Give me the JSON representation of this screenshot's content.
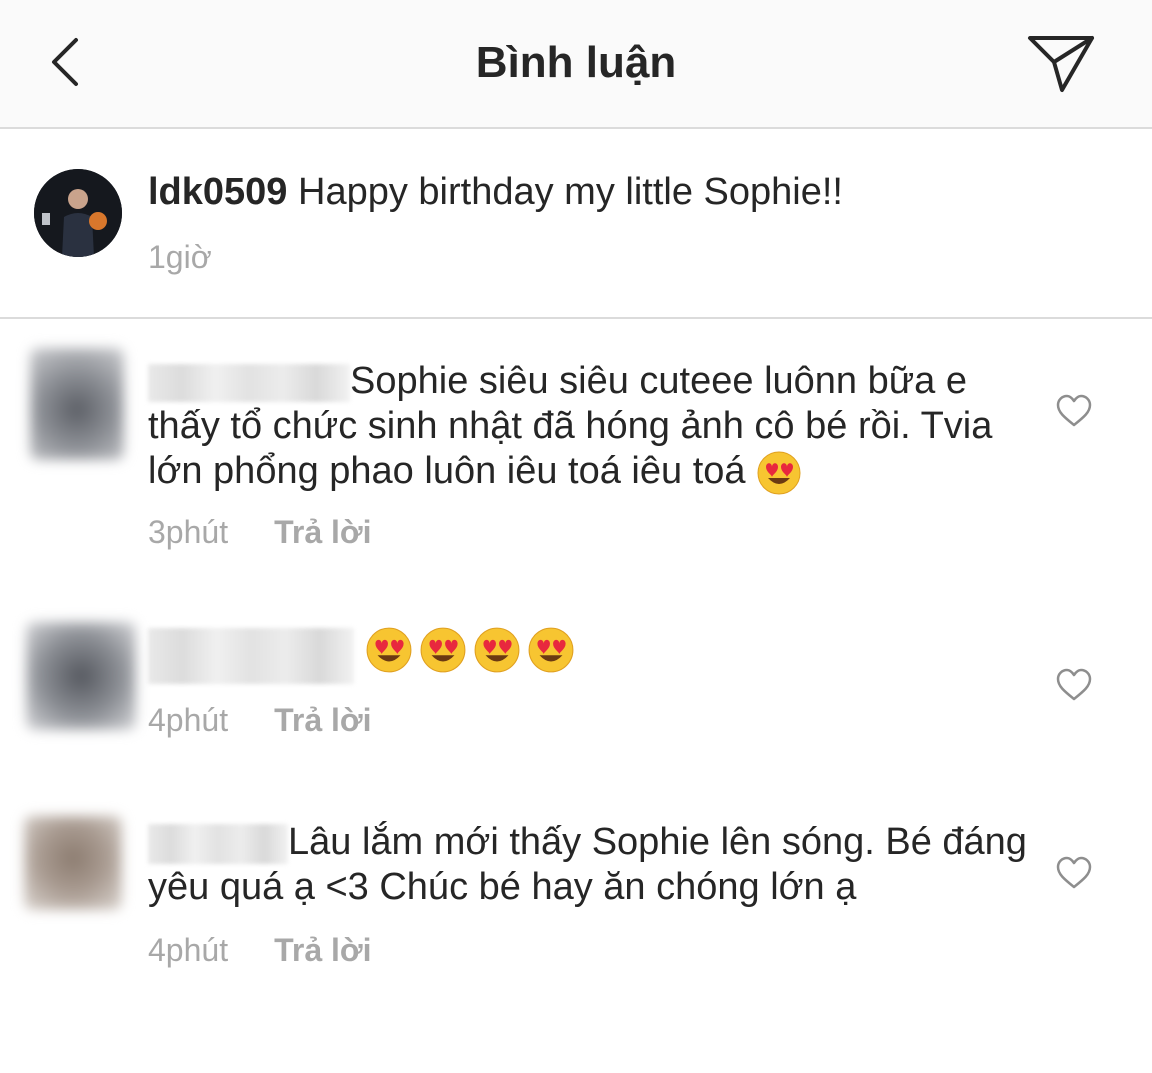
{
  "header": {
    "title": "Bình luận"
  },
  "caption": {
    "username": "ldk0509",
    "text": "Happy birthday my little Sophie!!",
    "time": "1giờ"
  },
  "comments": [
    {
      "text": "Sophie siêu siêu cuteee luônn bữa e thấy tổ chức sinh nhật đã hóng ảnh cô bé rồi. Tvia lớn phổng phao luôn iêu toá iêu toá",
      "time": "3phút",
      "reply": "Trả lời",
      "emoji": "heart-eyes-emoji"
    },
    {
      "text": "",
      "time": "4phút",
      "reply": "Trả lời",
      "emoji": "heart-eyes-emoji",
      "emoji_count": 4
    },
    {
      "text": "Lâu lắm mới thấy Sophie lên sóng. Bé đáng yêu quá ạ <3 Chúc bé hay ăn chóng lớn ạ",
      "time": "4phút",
      "reply": "Trả lời"
    }
  ],
  "icons": {
    "back": "chevron-left-icon",
    "send": "paper-plane-icon",
    "like": "heart-outline-icon"
  },
  "colors": {
    "header_bg": "#fafafa",
    "divider": "#dbdbdb",
    "meta": "#a8a8a8",
    "text": "#262626"
  }
}
